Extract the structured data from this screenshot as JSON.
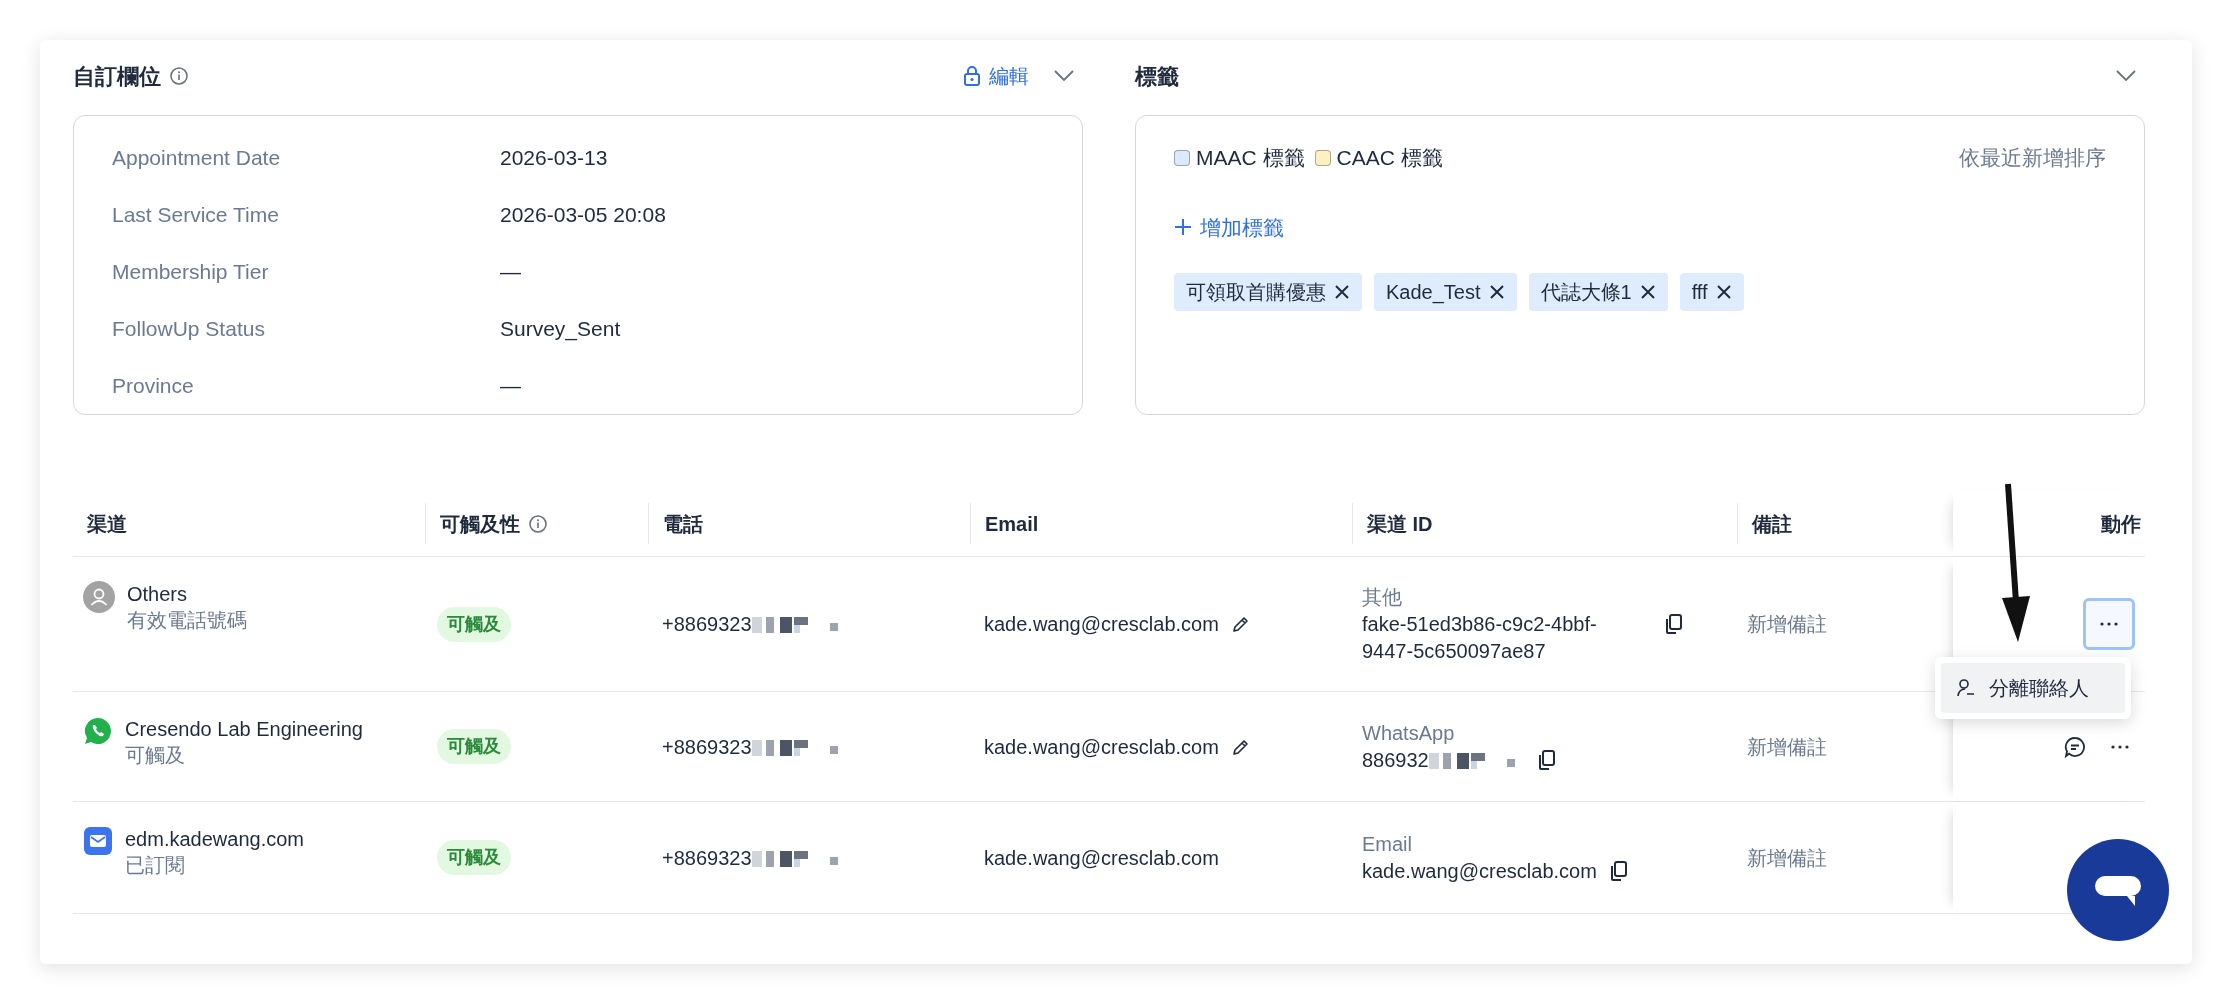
{
  "custom_fields": {
    "title": "自訂欄位",
    "edit_label": "編輯",
    "fields": [
      {
        "label": "Appointment Date",
        "value": "2026-03-13"
      },
      {
        "label": "Last Service Time",
        "value": "2026-03-05 20:08"
      },
      {
        "label": "Membership Tier",
        "value": "—"
      },
      {
        "label": "FollowUp Status",
        "value": "Survey_Sent"
      },
      {
        "label": "Province",
        "value": "—"
      }
    ]
  },
  "tags": {
    "title": "標籤",
    "legend": [
      {
        "label": "MAAC 標籤",
        "color": "#dbeafe"
      },
      {
        "label": "CAAC 標籤",
        "color": "#fdf0c4"
      }
    ],
    "sort_label": "依最近新增排序",
    "add_label": "增加標籤",
    "items": [
      {
        "label": "可領取首購優惠"
      },
      {
        "label": "Kade_Test"
      },
      {
        "label": "代誌大條1"
      },
      {
        "label": "fff"
      }
    ]
  },
  "table": {
    "columns": [
      {
        "label": "渠道",
        "info": false
      },
      {
        "label": "可觸及性",
        "info": true
      },
      {
        "label": "電話",
        "info": false
      },
      {
        "label": "Email",
        "info": false
      },
      {
        "label": "渠道 ID",
        "info": false
      },
      {
        "label": "備註",
        "info": false
      },
      {
        "label": "動作",
        "info": false
      }
    ],
    "rows": [
      {
        "kind": "others",
        "name": "Others",
        "status": "有效電話號碼",
        "reach": "可觸及",
        "phone": "+8869323",
        "email": "kade.wang@cresclab.com",
        "email_editable": true,
        "id_type": "其他",
        "id_value": "fake-51ed3b86-c9c2-4bbf-9447-5c650097ae87",
        "id_redacted": false,
        "note": "新增備註",
        "chat_button": false,
        "more_button": true,
        "more_focused": true,
        "menu": [
          {
            "label": "分離聯絡人"
          }
        ]
      },
      {
        "kind": "whatsapp",
        "name": "Cresendo Lab Engineering",
        "status": "可觸及",
        "reach": "可觸及",
        "phone": "+8869323",
        "email": "kade.wang@cresclab.com",
        "email_editable": true,
        "id_type": "WhatsApp",
        "id_value": "886932",
        "id_redacted": true,
        "note": "新增備註",
        "chat_button": true,
        "more_button": true,
        "more_focused": false
      },
      {
        "kind": "email",
        "name": "edm.kadewang.com",
        "status": "已訂閱",
        "reach": "可觸及",
        "phone": "+8869323",
        "email": "kade.wang@cresclab.com",
        "email_editable": false,
        "id_type": "Email",
        "id_value": "kade.wang@cresclab.com",
        "id_redacted": false,
        "note": "新增備註"
      }
    ]
  }
}
